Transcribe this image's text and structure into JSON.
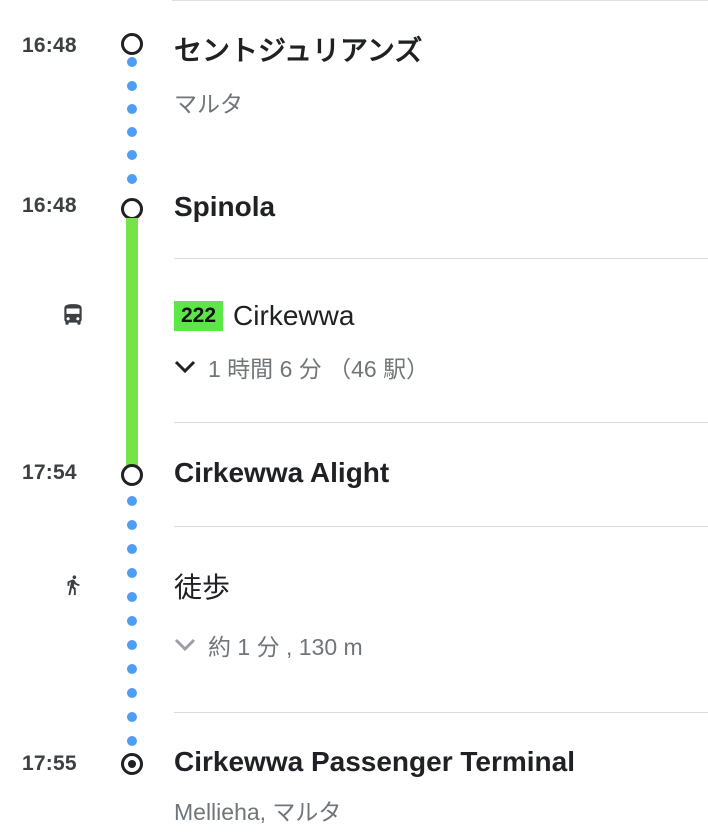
{
  "stops": [
    {
      "time": "16:48",
      "name": "セントジュリアンズ",
      "sub": "マルタ"
    },
    {
      "time": "16:48",
      "name": "Spinola"
    },
    {
      "time": "17:54",
      "name": "Cirkewwa Alight"
    },
    {
      "time": "17:55",
      "name": "Cirkewwa Passenger Terminal",
      "sub": "Mellieha, マルタ"
    }
  ],
  "bus_leg": {
    "route": "222",
    "headsign": "Cirkewwa",
    "detail": "1 時間 6 分 （46 駅）",
    "icon": "bus-icon",
    "line_color": "#76e348",
    "badge_color": "#5ce647"
  },
  "walk_leg": {
    "label": "徒歩",
    "detail": "約 1 分 , 130 m",
    "icon": "walk-icon",
    "dot_color": "#4e9ef5"
  }
}
